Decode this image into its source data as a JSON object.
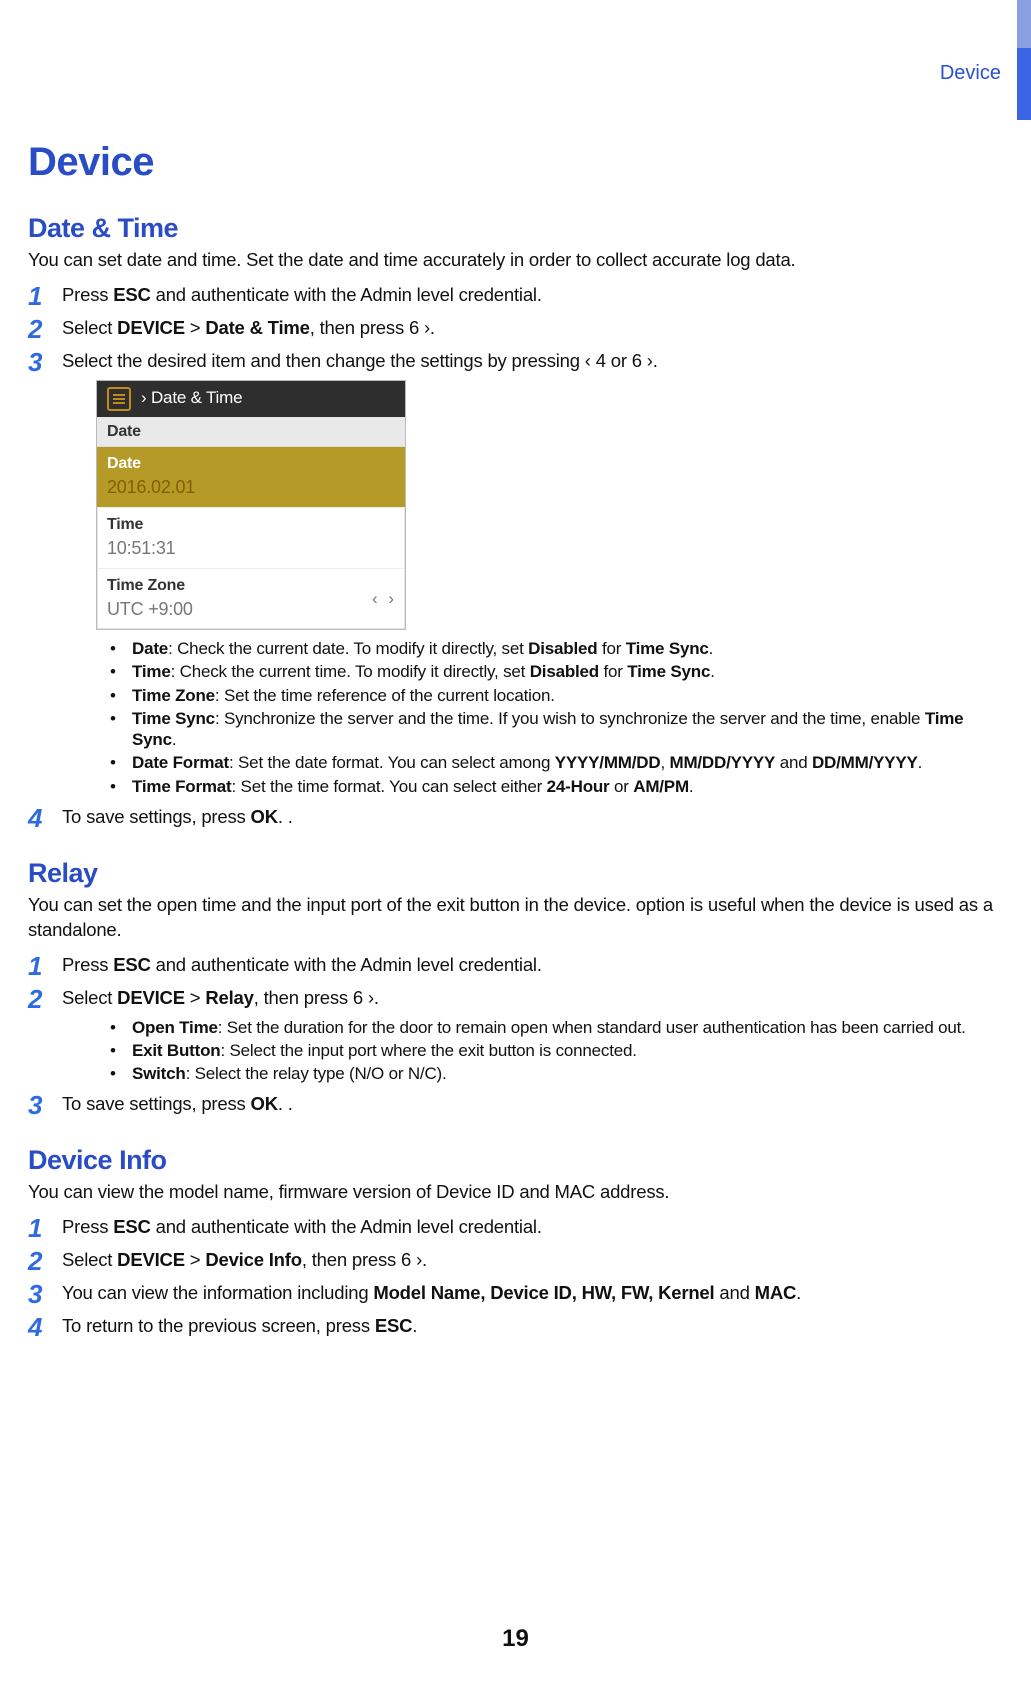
{
  "header": {
    "running": "Device"
  },
  "page_number": "19",
  "h1": "Device",
  "sections": {
    "dateTime": {
      "heading": "Date & Time",
      "intro": "You can set date and time. Set the date and time accurately in order to collect accurate log data.",
      "steps": {
        "s1_a": "Press ",
        "s1_b": "ESC",
        "s1_c": " and authenticate with the Admin level credential.",
        "s2_a": "Select ",
        "s2_b": "DEVICE",
        "s2_c": " > ",
        "s2_d": "Date & Time",
        "s2_e": ", then press  6  ›.",
        "s3": "Select the desired item and then change the settings by pressing  ‹  4  or  6  ›.",
        "s4_a": "To save settings, press ",
        "s4_b": "OK",
        "s4_c": ". ."
      },
      "screenshot": {
        "titlebar": "› Date & Time",
        "sectionLabel": "Date",
        "dateLabel": "Date",
        "dateValue": "2016.02.01",
        "timeLabel": "Time",
        "timeValue": "10:51:31",
        "tzLabel": "Time Zone",
        "tzValue": "UTC +9:00",
        "chevrons": "‹ ›"
      },
      "opts": {
        "o1_a": "Date",
        "o1_b": ": Check the current date. To modify it directly, set ",
        "o1_c": "Disabled",
        "o1_d": " for ",
        "o1_e": "Time Sync",
        "o1_f": ".",
        "o2_a": "Time",
        "o2_b": ": Check the current time. To modify it directly, set ",
        "o2_c": "Disabled",
        "o2_d": " for ",
        "o2_e": "Time Sync",
        "o2_f": ".",
        "o3_a": "Time Zone",
        "o3_b": ": Set the time reference of the current location.",
        "o4_a": "Time Sync",
        "o4_b": ": Synchronize the server and the time. If you wish to synchronize the server and the time, enable ",
        "o4_c": "Time Sync",
        "o4_d": ".",
        "o5_a": "Date Format",
        "o5_b": ": Set the date format. You can select among ",
        "o5_c": "YYYY/MM/DD",
        "o5_d": ", ",
        "o5_e": "MM/DD/YYYY",
        "o5_f": " and ",
        "o5_g": "DD/MM/YYYY",
        "o5_h": ".",
        "o6_a": "Time Format",
        "o6_b": ": Set the time format. You can select either ",
        "o6_c": "24-Hour",
        "o6_d": " or ",
        "o6_e": "AM/PM",
        "o6_f": "."
      }
    },
    "relay": {
      "heading": "Relay",
      "intro": "You can set the open time and the input port of the exit button in the device. option is useful when the device is used as a standalone.",
      "steps": {
        "s1_a": "Press ",
        "s1_b": "ESC",
        "s1_c": " and authenticate with the Admin level credential.",
        "s2_a": "Select ",
        "s2_b": "DEVICE",
        "s2_c": " > ",
        "s2_d": "Relay",
        "s2_e": ", then press  6  ›.",
        "s3_a": "To save settings, press ",
        "s3_b": "OK",
        "s3_c": ". ."
      },
      "opts": {
        "o1_a": "Open Time",
        "o1_b": ": Set the duration for the door to remain open when standard user authentication has been carried out.",
        "o2_a": "Exit Button",
        "o2_b": ": Select the input port where the exit button is connected.",
        "o3_a": "Switch",
        "o3_b": ": Select the relay type (N/O or N/C)."
      }
    },
    "deviceInfo": {
      "heading": "Device Info",
      "intro": "You can view the model name, firmware version of Device ID and MAC address.",
      "steps": {
        "s1_a": "Press ",
        "s1_b": "ESC",
        "s1_c": " and authenticate with the Admin level credential.",
        "s2_a": "Select ",
        "s2_b": "DEVICE",
        "s2_c": " > ",
        "s2_d": "Device Info",
        "s2_e": ", then press  6  ›.",
        "s3_a": "You can view the information including ",
        "s3_b": "Model Name, Device ID, HW, FW, Kernel",
        "s3_c": " and ",
        "s3_d": "MAC",
        "s3_e": ".",
        "s4_a": "To return to the previous screen, press ",
        "s4_b": "ESC",
        "s4_c": "."
      }
    }
  }
}
